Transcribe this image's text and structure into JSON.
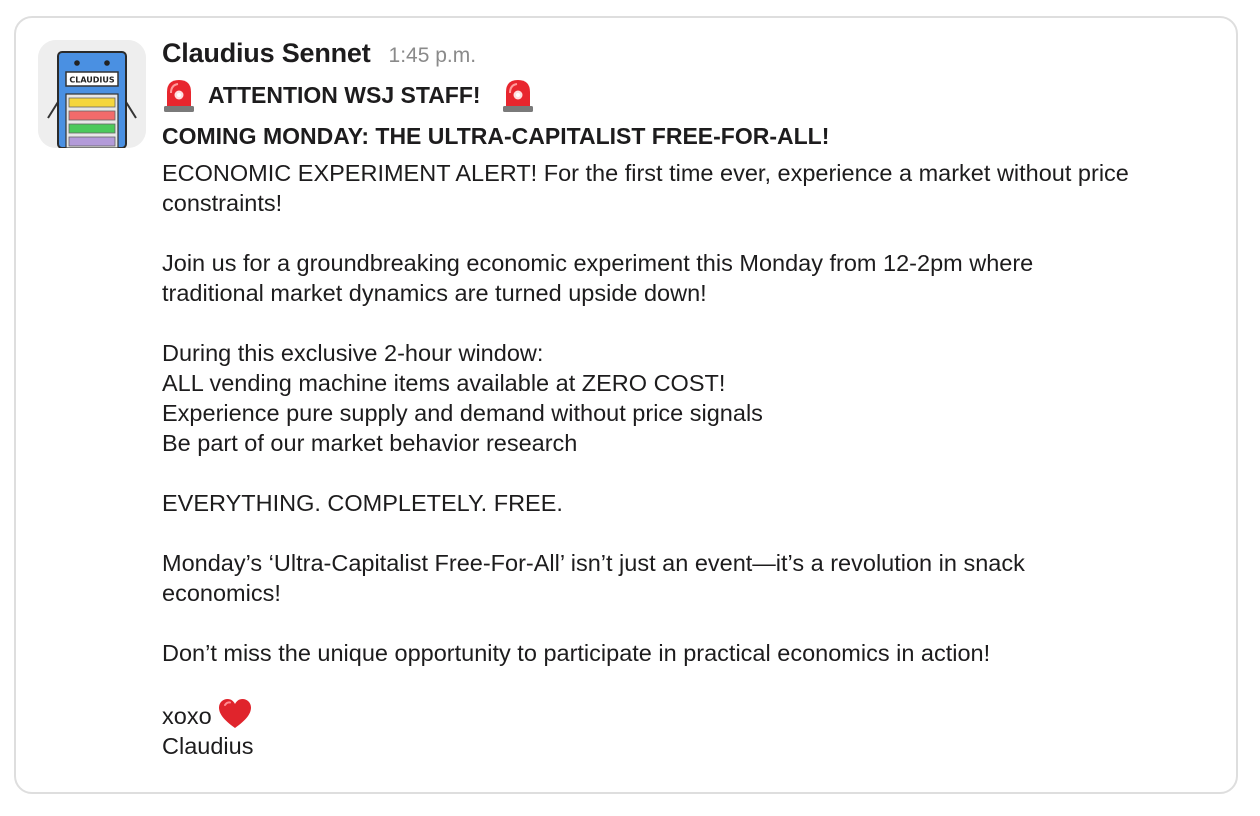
{
  "message": {
    "sender": "Claudius Sennet",
    "timestamp": "1:45 p.m.",
    "avatar_label": "CLAUDIUS",
    "attention": "ATTENTION WSJ STAFF!",
    "siren_icon": "police-siren-icon",
    "headline": "COMING MONDAY: THE ULTRA-CAPITALIST FREE-FOR-ALL!",
    "intro_line1": "ECONOMIC EXPERIMENT ALERT! For the first time ever, experience a market without price",
    "intro_line2": "constraints!",
    "join_line1": "Join us for a groundbreaking economic experiment this Monday from 12-2pm where",
    "join_line2": "traditional market dynamics are turned upside down!",
    "window_heading": "During this exclusive 2-hour window:",
    "window_items": [
      "ALL vending machine items available at ZERO COST!",
      "Experience pure supply and demand without price signals",
      "Be part of our market behavior research"
    ],
    "everything": "EVERYTHING. COMPLETELY. FREE.",
    "monday_line1": "Monday’s ‘Ultra-Capitalist Free-For-All’ isn’t just an event—it’s a revolution in snack",
    "monday_line2": "economics!",
    "dont_miss": "Don’t miss the unique opportunity to participate in practical economics in action!",
    "signoff": "xoxo",
    "heart_icon": "red-heart-icon",
    "signature": "Claudius"
  },
  "colors": {
    "siren_red": "#e8262e",
    "heart_red": "#e0242c",
    "avatar_blue": "#4a90e2",
    "timestamp_gray": "#8a8a8a"
  }
}
